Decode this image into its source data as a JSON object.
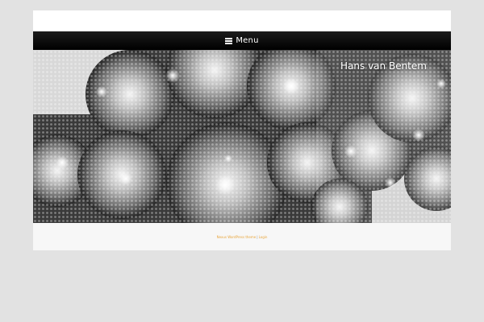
{
  "nav": {
    "menu_icon": "menu-bars-icon",
    "menu_label": "Menu"
  },
  "hero": {
    "title": "Hans van Bentem",
    "image": "black-and-white chandelier of glass beads"
  },
  "footer": {
    "theme_link": "Nexus WordPress theme",
    "separator": "|",
    "login_link": "Login"
  },
  "colors": {
    "background": "#e2e2e2",
    "nav": "#000000",
    "footer_link": "#e8a53a"
  }
}
